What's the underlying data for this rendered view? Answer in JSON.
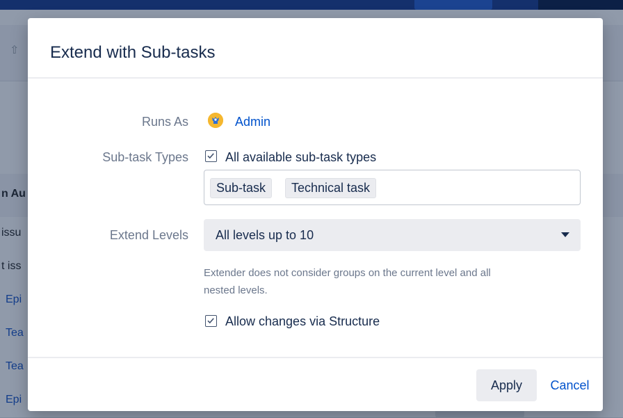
{
  "background": {
    "header_text": "n Au",
    "rows": [
      {
        "text": "issu",
        "style": "dark"
      },
      {
        "text": "t iss",
        "style": "dark"
      },
      {
        "text": "Epi",
        "style": "link"
      },
      {
        "text": "Tea",
        "style": "link"
      },
      {
        "text": "Tea",
        "style": "link"
      },
      {
        "text": "Epi",
        "style": "link"
      }
    ],
    "up_arrow_icon": "arrow-up-icon"
  },
  "dialog": {
    "title": "Extend with Sub-tasks",
    "runs_as": {
      "label": "Runs As",
      "user": "Admin",
      "avatar_icon": "user-avatar-icon"
    },
    "subtask_types": {
      "label": "Sub-task Types",
      "checkbox_label": "All available sub-task types",
      "checked": true,
      "tags": [
        "Sub-task",
        "Technical task"
      ]
    },
    "extend_levels": {
      "label": "Extend Levels",
      "selected": "All levels up to 10",
      "caret_icon": "caret-down-icon",
      "helper_line1": "Extender does not consider groups on the current level and all",
      "helper_line2": "nested levels."
    },
    "allow_changes": {
      "label": "Allow changes via Structure",
      "checked": true
    },
    "footer": {
      "apply": "Apply",
      "cancel": "Cancel"
    }
  },
  "colors": {
    "link": "#0052cc",
    "label": "#6b778c",
    "text": "#172b4d",
    "overlay": "rgba(9,30,66,0.45)"
  }
}
